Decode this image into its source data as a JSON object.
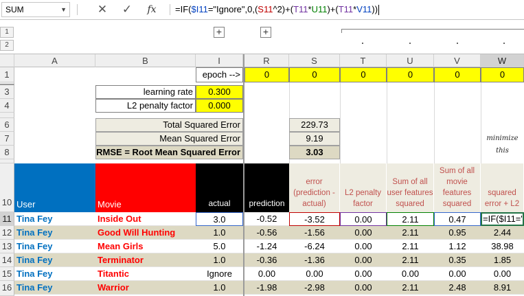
{
  "formula_bar": {
    "name_box": "SUM",
    "cancel_icon": "close-icon",
    "enter_icon": "check-icon",
    "fx_label": "fx",
    "formula_parts": [
      "=IF(",
      "$I11",
      "=\"Ignore\",0,(",
      "S11",
      "^2)+(",
      "T11",
      "*",
      "U11",
      ")+(",
      "T11",
      "*",
      "V11",
      "))"
    ]
  },
  "outline": {
    "levels": [
      "1",
      "2"
    ],
    "expand_buttons": [
      "+",
      "+"
    ]
  },
  "columns": [
    "A",
    "B",
    "I",
    "R",
    "S",
    "T",
    "U",
    "V",
    "W"
  ],
  "rows": [
    "1",
    "3",
    "4",
    "6",
    "7",
    "8",
    "10",
    "11",
    "12",
    "13",
    "14",
    "15",
    "16"
  ],
  "epoch": {
    "label": "epoch -->",
    "values": [
      "0",
      "0",
      "0",
      "0",
      "0",
      "0"
    ]
  },
  "params": {
    "learning_rate_label": "learning rate",
    "learning_rate": "0.300",
    "l2_label": "L2 penalty factor",
    "l2": "0.000"
  },
  "errors": {
    "total_label": "Total Squared Error",
    "total": "229.73",
    "mean_label": "Mean Squared Error",
    "mean": "9.19",
    "rmse_label": "RMSE = Root Mean Squared Error",
    "rmse": "3.03",
    "note1": "minimize",
    "note2": "this"
  },
  "table_headers": {
    "user": "User",
    "movie": "Movie",
    "actual": "actual",
    "prediction": "prediction",
    "error": "error (prediction - actual)",
    "l2_penalty": "L2 penalty factor",
    "sum_user": "Sum of all user features squared",
    "sum_movie": "Sum of all movie features squared",
    "sq_error": "squared error + L2"
  },
  "table_rows": [
    {
      "row": "11",
      "user": "Tina Fey",
      "movie": "Inside Out",
      "actual": "3.0",
      "prediction": "-0.52",
      "error": "-3.52",
      "l2": "0.00",
      "sum_user": "2.11",
      "sum_movie": "0.47",
      "sq_error": "=IF($I11=\""
    },
    {
      "row": "12",
      "user": "Tina Fey",
      "movie": "Good Will Hunting",
      "actual": "1.0",
      "prediction": "-0.56",
      "error": "-1.56",
      "l2": "0.00",
      "sum_user": "2.11",
      "sum_movie": "0.95",
      "sq_error": "2.44"
    },
    {
      "row": "13",
      "user": "Tina Fey",
      "movie": "Mean Girls",
      "actual": "5.0",
      "prediction": "-1.24",
      "error": "-6.24",
      "l2": "0.00",
      "sum_user": "2.11",
      "sum_movie": "1.12",
      "sq_error": "38.98"
    },
    {
      "row": "14",
      "user": "Tina Fey",
      "movie": "Terminator",
      "actual": "1.0",
      "prediction": "-0.36",
      "error": "-1.36",
      "l2": "0.00",
      "sum_user": "2.11",
      "sum_movie": "0.35",
      "sq_error": "1.85"
    },
    {
      "row": "15",
      "user": "Tina Fey",
      "movie": "Titantic",
      "actual": "Ignore",
      "prediction": "0.00",
      "error": "0.00",
      "l2": "0.00",
      "sum_user": "0.00",
      "sum_movie": "0.00",
      "sq_error": "0.00"
    },
    {
      "row": "16",
      "user": "Tina Fey",
      "movie": "Warrior",
      "actual": "1.0",
      "prediction": "-1.98",
      "error": "-2.98",
      "l2": "0.00",
      "sum_user": "2.11",
      "sum_movie": "2.48",
      "sq_error": "8.91"
    }
  ],
  "colors": {
    "user_header": "#0070c0",
    "movie_header": "#ff0000",
    "actual_header": "#000000",
    "input_yellow": "#ffff00",
    "band": "#ddd9c3"
  }
}
